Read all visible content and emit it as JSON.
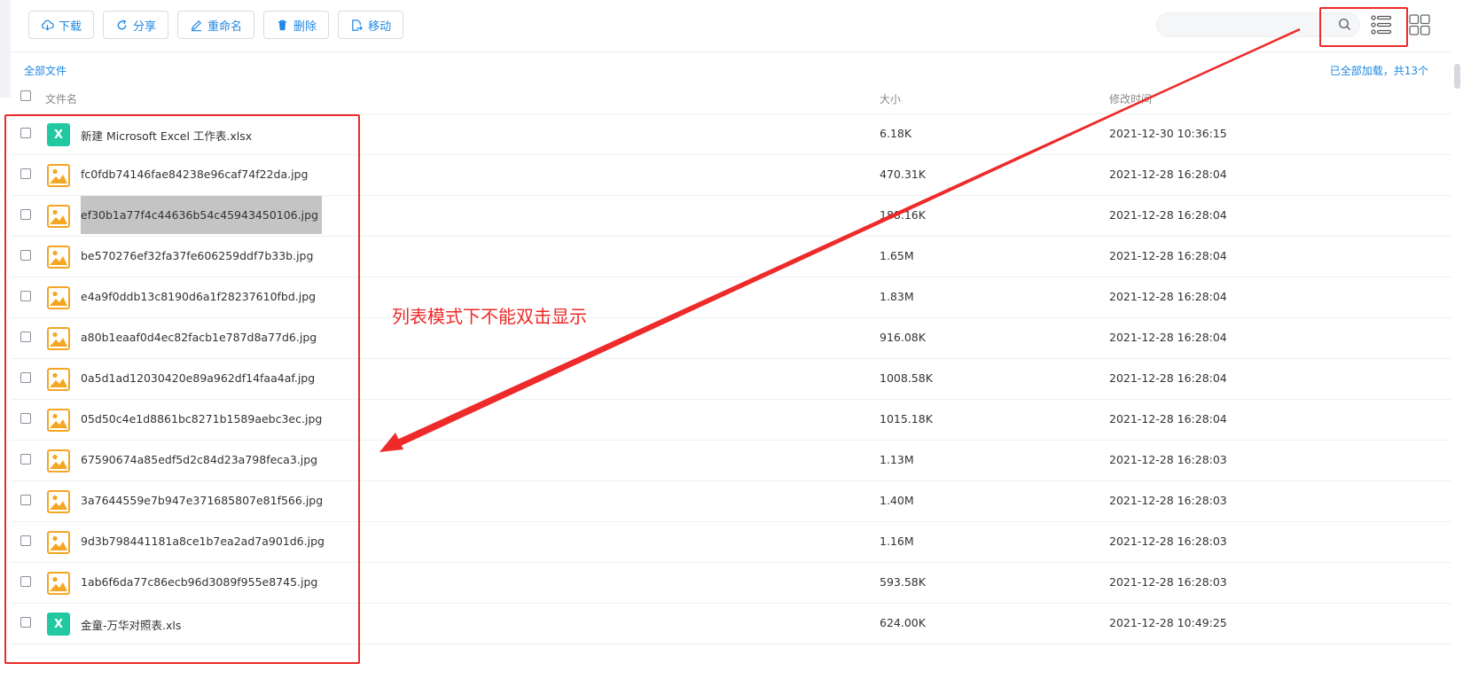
{
  "toolbar": {
    "download_label": "下载",
    "share_label": "分享",
    "rename_label": "重命名",
    "delete_label": "删除",
    "move_label": "移动"
  },
  "search": {
    "placeholder": "",
    "value": ""
  },
  "breadcrumb": "全部文件",
  "status": "已全部加载，共13个",
  "columns": {
    "name": "文件名",
    "size": "大小",
    "modified": "修改时间"
  },
  "files": [
    {
      "type": "excel",
      "name": "新建 Microsoft Excel 工作表.xlsx",
      "size": "6.18K",
      "modified": "2021-12-30 10:36:15"
    },
    {
      "type": "image",
      "name": "fc0fdb74146fae84238e96caf74f22da.jpg",
      "size": "470.31K",
      "modified": "2021-12-28 16:28:04"
    },
    {
      "type": "image",
      "name": "ef30b1a77f4c44636b54c45943450106.jpg",
      "size": "188.16K",
      "modified": "2021-12-28 16:28:04",
      "selected": true
    },
    {
      "type": "image",
      "name": "be570276ef32fa37fe606259ddf7b33b.jpg",
      "size": "1.65M",
      "modified": "2021-12-28 16:28:04"
    },
    {
      "type": "image",
      "name": "e4a9f0ddb13c8190d6a1f28237610fbd.jpg",
      "size": "1.83M",
      "modified": "2021-12-28 16:28:04"
    },
    {
      "type": "image",
      "name": "a80b1eaaf0d4ec82facb1e787d8a77d6.jpg",
      "size": "916.08K",
      "modified": "2021-12-28 16:28:04"
    },
    {
      "type": "image",
      "name": "0a5d1ad12030420e89a962df14faa4af.jpg",
      "size": "1008.58K",
      "modified": "2021-12-28 16:28:04"
    },
    {
      "type": "image",
      "name": "05d50c4e1d8861bc8271b1589aebc3ec.jpg",
      "size": "1015.18K",
      "modified": "2021-12-28 16:28:04"
    },
    {
      "type": "image",
      "name": "67590674a85edf5d2c84d23a798feca3.jpg",
      "size": "1.13M",
      "modified": "2021-12-28 16:28:03"
    },
    {
      "type": "image",
      "name": "3a7644559e7b947e371685807e81f566.jpg",
      "size": "1.40M",
      "modified": "2021-12-28 16:28:03"
    },
    {
      "type": "image",
      "name": "9d3b798441181a8ce1b7ea2ad7a901d6.jpg",
      "size": "1.16M",
      "modified": "2021-12-28 16:28:03"
    },
    {
      "type": "image",
      "name": "1ab6f6da77c86ecb96d3089f955e8745.jpg",
      "size": "593.58K",
      "modified": "2021-12-28 16:28:03"
    },
    {
      "type": "excel",
      "name": "金童-万华对照表.xls",
      "size": "624.00K",
      "modified": "2021-12-28 10:49:25"
    }
  ],
  "annotation": {
    "text": "列表模式下不能双击显示",
    "color": "#ee2a2a"
  },
  "colors": {
    "accent": "#1e88e5",
    "excel_icon": "#21c8a0",
    "image_icon": "#f5a623"
  }
}
